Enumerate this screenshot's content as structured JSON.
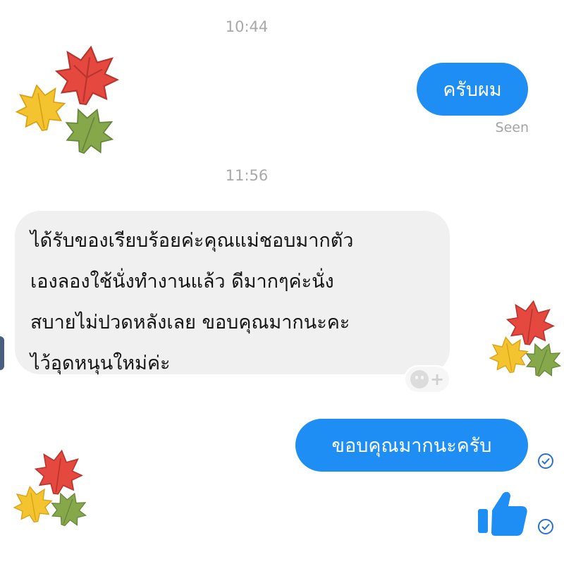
{
  "conversation": {
    "timestamp_1": "10:44",
    "timestamp_2": "11:56",
    "messages": [
      {
        "direction": "outgoing",
        "text": "ครับผม"
      },
      {
        "direction": "incoming",
        "lines": [
          "ได้รับของเรียบร้อยค่ะคุณแม่ชอบมากตัว",
          "เองลองใช้นั่งทำงานแล้ว ดีมากๆค่ะนั่ง",
          "สบายไม่ปวดหลังเลย ขอบคุณมากนะคะ",
          "ไว้อุดหนุนใหม่ค่ะ"
        ]
      },
      {
        "direction": "outgoing",
        "text": "ขอบคุณมากนะครับ"
      }
    ],
    "seen_label": "Seen",
    "like_icon": "thumbs-up-icon",
    "react_icon": "add-reaction-icon",
    "delivered_icon": "delivered-check-icon"
  },
  "decorations": {
    "sticker": "autumn-leaves",
    "leaf_colors": [
      "#e5483f",
      "#f4c430",
      "#86a84a"
    ]
  },
  "colors": {
    "outgoing_bubble": "#1e8ef5",
    "incoming_bubble": "#f0f0f0",
    "timestamp": "#a8a8a8",
    "like": "#1e8ef5"
  }
}
